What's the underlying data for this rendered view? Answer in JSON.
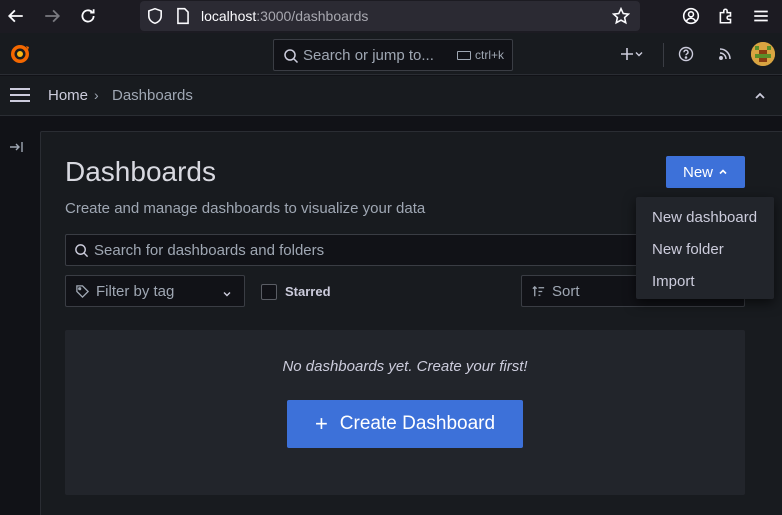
{
  "browser": {
    "url_host": "localhost",
    "url_path": ":3000/dashboards"
  },
  "topbar": {
    "search_placeholder": "Search or jump to...",
    "search_shortcut": "ctrl+k"
  },
  "breadcrumb": {
    "home": "Home",
    "separator": "›",
    "current": "Dashboards"
  },
  "page": {
    "title": "Dashboards",
    "subtitle": "Create and manage dashboards to visualize your data",
    "new_button": "New",
    "search_placeholder": "Search for dashboards and folders",
    "filter_tag_placeholder": "Filter by tag",
    "starred_label": "Starred",
    "sort_placeholder": "Sort"
  },
  "new_menu": {
    "items": [
      "New dashboard",
      "New folder",
      "Import"
    ]
  },
  "empty_state": {
    "message": "No dashboards yet. Create your first!",
    "create_button": "Create Dashboard"
  },
  "colors": {
    "primary": "#3d71d9",
    "background": "#111217",
    "panel": "#181b1f"
  }
}
